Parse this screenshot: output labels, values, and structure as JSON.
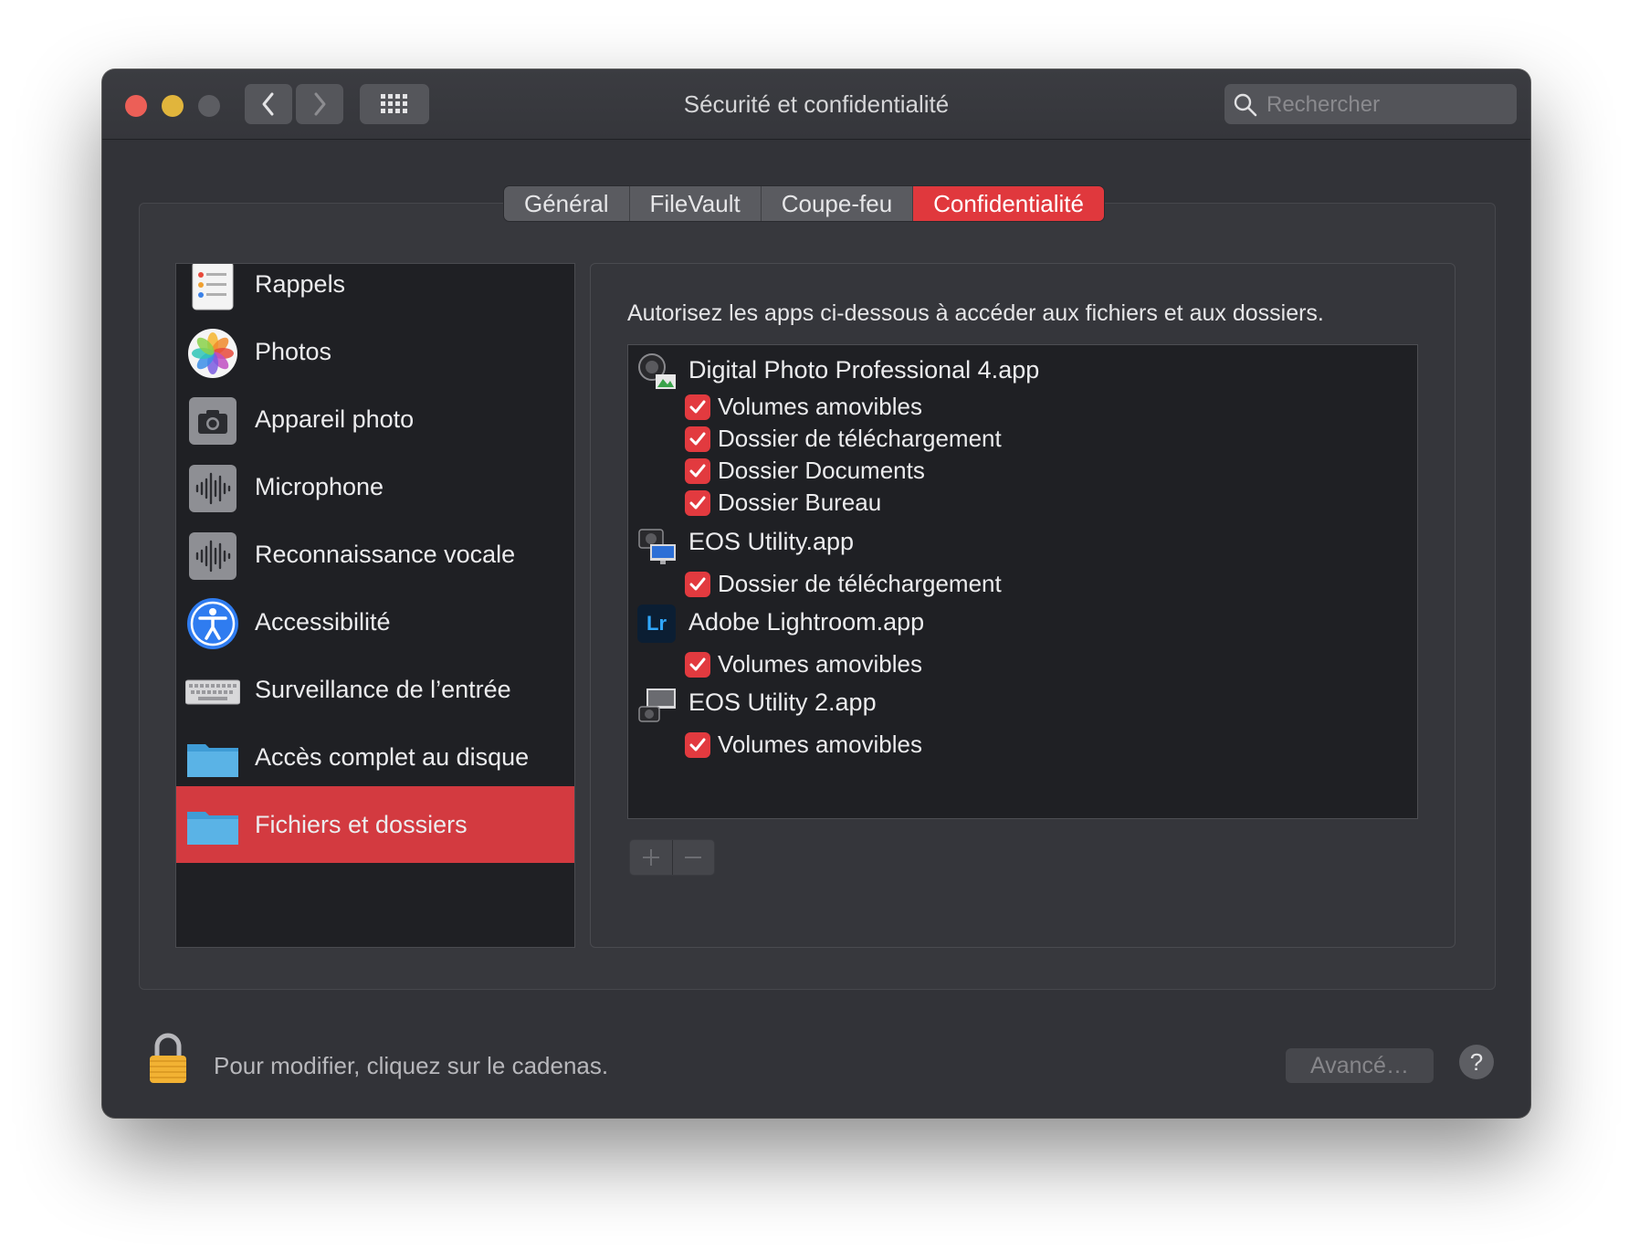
{
  "window": {
    "title": "Sécurité et confidentialité",
    "search_placeholder": "Rechercher"
  },
  "tabs": [
    {
      "label": "Général"
    },
    {
      "label": "FileVault"
    },
    {
      "label": "Coupe-feu"
    },
    {
      "label": "Confidentialité",
      "active": true
    }
  ],
  "sidebar": {
    "items": [
      {
        "label": "Rappels",
        "icon": "reminders-icon"
      },
      {
        "label": "Photos",
        "icon": "photos-icon"
      },
      {
        "label": "Appareil photo",
        "icon": "camera-icon"
      },
      {
        "label": "Microphone",
        "icon": "microphone-icon"
      },
      {
        "label": "Reconnaissance vocale",
        "icon": "speech-recognition-icon"
      },
      {
        "label": "Accessibilité",
        "icon": "accessibility-icon"
      },
      {
        "label": "Surveillance de l’entrée",
        "icon": "keyboard-icon"
      },
      {
        "label": "Accès complet au disque",
        "icon": "folder-icon"
      },
      {
        "label": "Fichiers et dossiers",
        "icon": "folder-icon",
        "selected": true
      }
    ]
  },
  "main": {
    "description": "Autorisez les apps ci-dessous à accéder aux fichiers et aux dossiers.",
    "apps": [
      {
        "name": "Digital Photo Professional 4.app",
        "icon": "digital-photo-professional-icon",
        "permissions": [
          {
            "label": "Volumes amovibles",
            "checked": true
          },
          {
            "label": "Dossier de téléchargement",
            "checked": true
          },
          {
            "label": "Dossier Documents",
            "checked": true
          },
          {
            "label": "Dossier Bureau",
            "checked": true
          }
        ]
      },
      {
        "name": "EOS Utility.app",
        "icon": "eos-utility-icon",
        "permissions": [
          {
            "label": "Dossier de téléchargement",
            "checked": true
          }
        ]
      },
      {
        "name": "Adobe Lightroom.app",
        "icon": "lightroom-icon",
        "icon_text": "Lr",
        "permissions": [
          {
            "label": "Volumes amovibles",
            "checked": true
          }
        ]
      },
      {
        "name": "EOS Utility 2.app",
        "icon": "eos-utility-2-icon",
        "permissions": [
          {
            "label": "Volumes amovibles",
            "checked": true
          }
        ]
      }
    ]
  },
  "footer": {
    "lock_message": "Pour modifier, cliquez sur le cadenas.",
    "advanced_label": "Avancé…",
    "help_label": "?"
  },
  "colors": {
    "accent": "#e0383d",
    "window_bg": "#323338",
    "list_bg": "#1f2024"
  }
}
